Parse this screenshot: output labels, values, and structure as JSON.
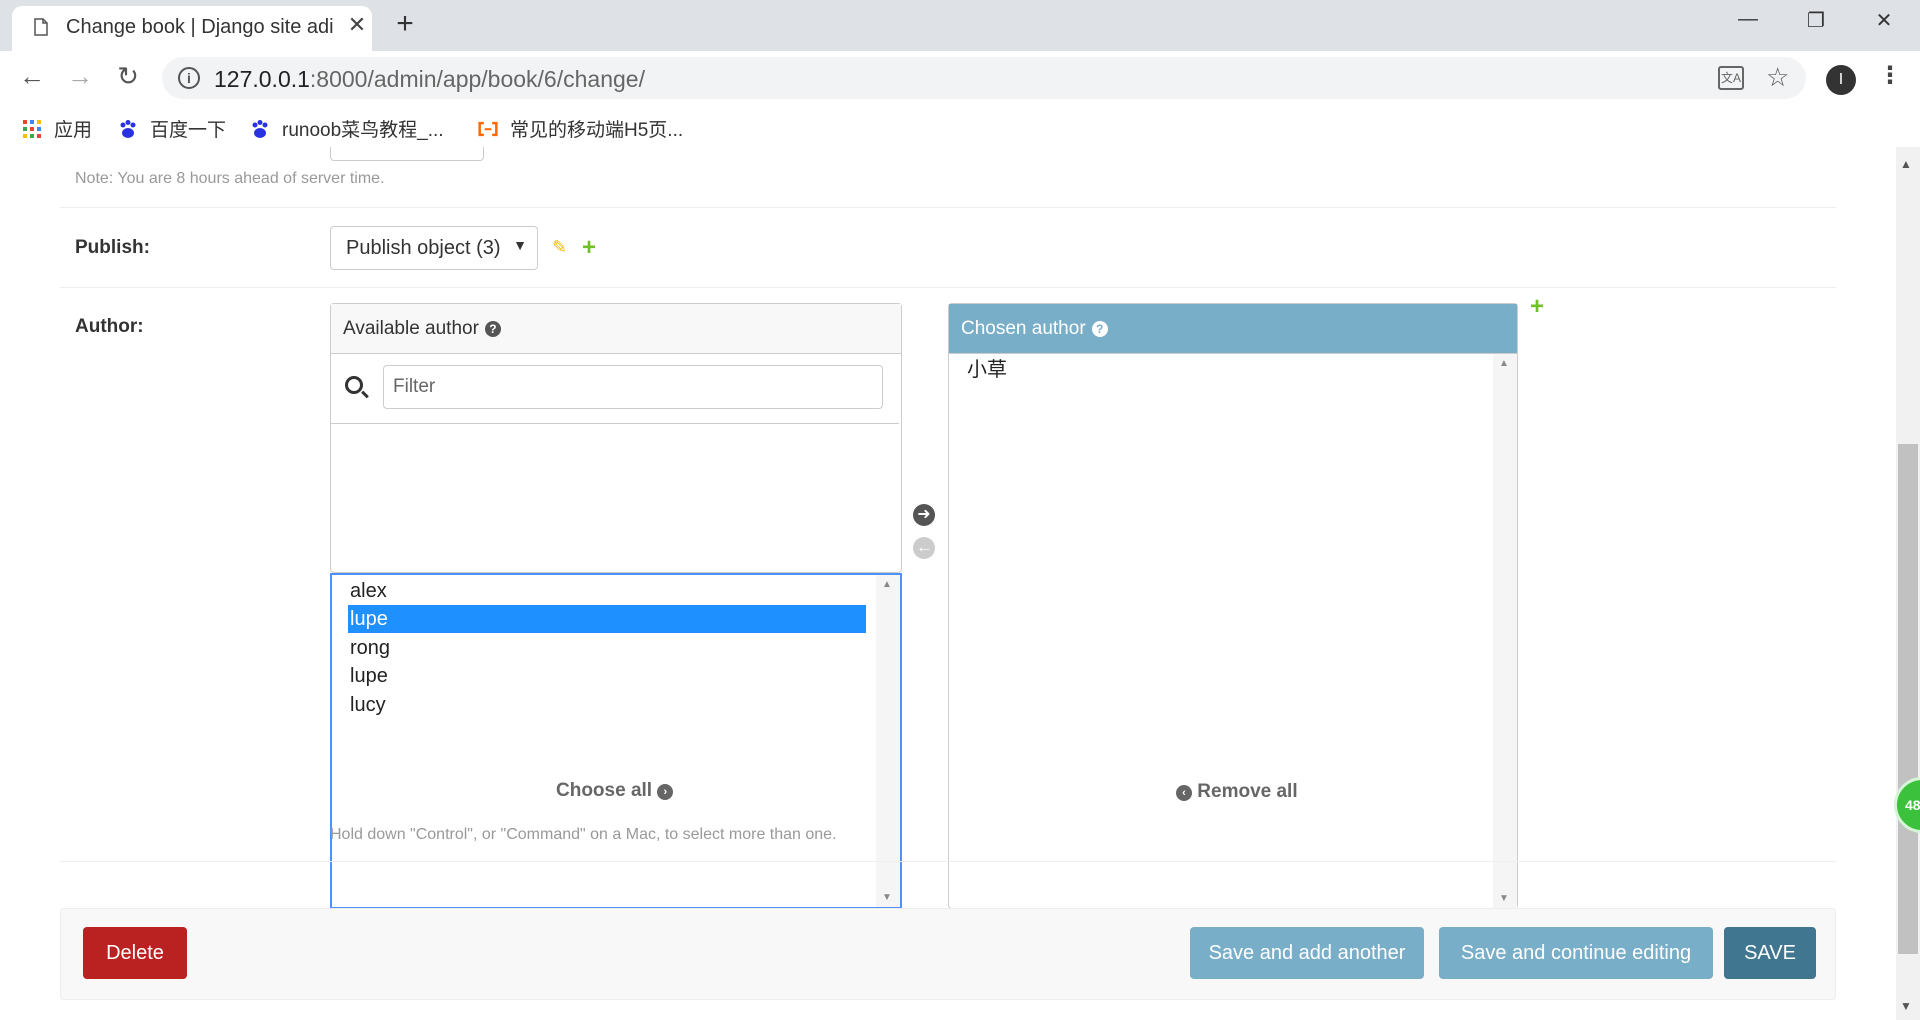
{
  "browser": {
    "tab_title": "Change book | Django site adi",
    "url_host": "127.0.0.1",
    "url_rest": ":8000/admin/app/book/6/change/",
    "bookmarks": [
      {
        "label": "应用"
      },
      {
        "label": "百度一下"
      },
      {
        "label": "runoob菜鸟教程_..."
      },
      {
        "label": "常见的移动端H5页..."
      }
    ],
    "profile_initial": "I"
  },
  "form": {
    "timezone_note": "Note: You are 8 hours ahead of server time.",
    "publish": {
      "label": "Publish:",
      "selected": "Publish object (3)"
    },
    "author": {
      "label": "Author:",
      "available_title": "Available author",
      "chosen_title": "Chosen author",
      "filter_placeholder": "Filter",
      "available_options": [
        {
          "text": "alex",
          "selected": false
        },
        {
          "text": "lupe",
          "selected": true
        },
        {
          "text": "rong",
          "selected": false
        },
        {
          "text": "lupe",
          "selected": false
        },
        {
          "text": "lucy",
          "selected": false
        }
      ],
      "chosen_options": [
        "小草"
      ],
      "choose_all": "Choose all",
      "remove_all": "Remove all",
      "help": "Hold down \"Control\", or \"Command\" on a Mac, to select more than one."
    }
  },
  "submit": {
    "delete": "Delete",
    "save_add": "Save and add another",
    "save_continue": "Save and continue editing",
    "save": "SAVE"
  },
  "overlay_badge": "48",
  "colors": {
    "header_blue": "#79aec8",
    "delete_red": "#ba2121",
    "save_dark": "#417690",
    "add_green": "#70bf2b"
  }
}
